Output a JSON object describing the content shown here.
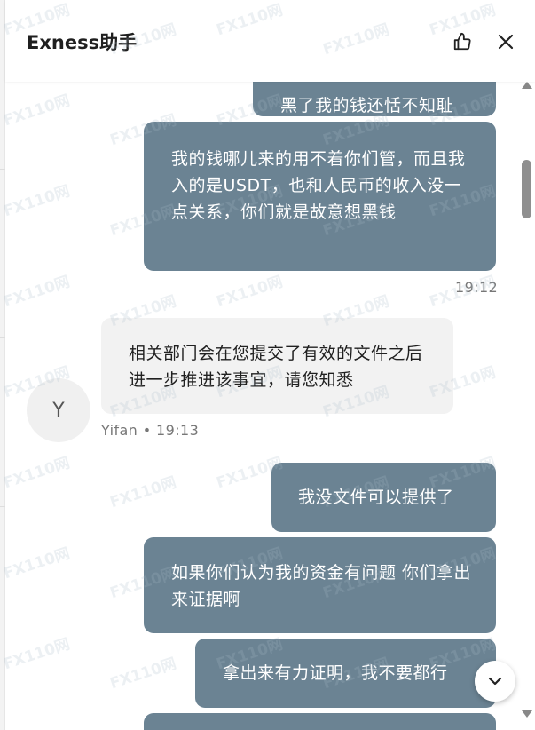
{
  "header": {
    "title": "Exness助手"
  },
  "messages": [
    {
      "text": "黑了我的钱还恬不知耻"
    },
    {
      "text": "我的钱哪儿来的用不着你们管，而且我入的是USDT，也和人民币的收入没一点关系，你们就是故意想黑钱",
      "time": "19:12"
    },
    {
      "text": "相关部门会在您提交了有效的文件之后进一步推进该事宜，请您知悉",
      "sender": "Yifan",
      "time": "19:13",
      "avatar_letter": "Y"
    },
    {
      "text": "我没文件可以提供了"
    },
    {
      "text": "如果你们认为我的资金有问题 你们拿出来证据啊"
    },
    {
      "text": "拿出来有力证明，我不要都行"
    }
  ],
  "meta_line": "Yifan • 19:13",
  "watermark": "FX110网",
  "icons": {
    "like": "thumbs-up-icon",
    "close": "close-icon",
    "scroll_down": "chevron-down-icon"
  },
  "colors": {
    "outgoing_bubble": "#6b8393",
    "incoming_bubble": "#f2f2f2"
  }
}
